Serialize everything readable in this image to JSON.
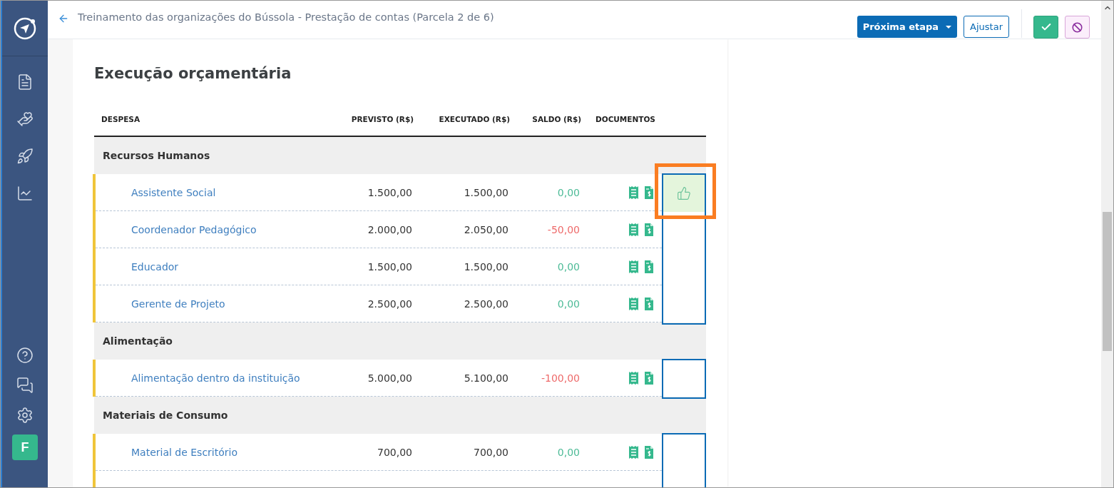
{
  "header": {
    "title": "Treinamento das organizações do Bússola - Prestação de contas (Parcela 2 de 6)",
    "primary_button": "Próxima etapa",
    "secondary_button": "Ajustar"
  },
  "avatar": "F",
  "section_title": "Execução orçamentária",
  "table": {
    "columns": [
      "DESPESA",
      "PREVISTO (R$)",
      "EXECUTADO (R$)",
      "SALDO (R$)",
      "DOCUMENTOS"
    ],
    "groups": [
      {
        "name": "Recursos Humanos",
        "items": [
          {
            "name": "Assistente Social",
            "previsto": "1.500,00",
            "executado": "1.500,00",
            "saldo": "0,00",
            "negative": false,
            "approved": true
          },
          {
            "name": "Coordenador Pedagógico",
            "previsto": "2.000,00",
            "executado": "2.050,00",
            "saldo": "-50,00",
            "negative": true,
            "approved": false
          },
          {
            "name": "Educador",
            "previsto": "1.500,00",
            "executado": "1.500,00",
            "saldo": "0,00",
            "negative": false,
            "approved": false
          },
          {
            "name": "Gerente de Projeto",
            "previsto": "2.500,00",
            "executado": "2.500,00",
            "saldo": "0,00",
            "negative": false,
            "approved": false
          }
        ]
      },
      {
        "name": "Alimentação",
        "items": [
          {
            "name": "Alimentação dentro da instituição",
            "previsto": "5.000,00",
            "executado": "5.100,00",
            "saldo": "-100,00",
            "negative": true,
            "approved": false
          }
        ]
      },
      {
        "name": "Materiais de Consumo",
        "items": [
          {
            "name": "Material de Escritório",
            "previsto": "700,00",
            "executado": "700,00",
            "saldo": "0,00",
            "negative": false,
            "approved": false
          }
        ]
      }
    ]
  }
}
